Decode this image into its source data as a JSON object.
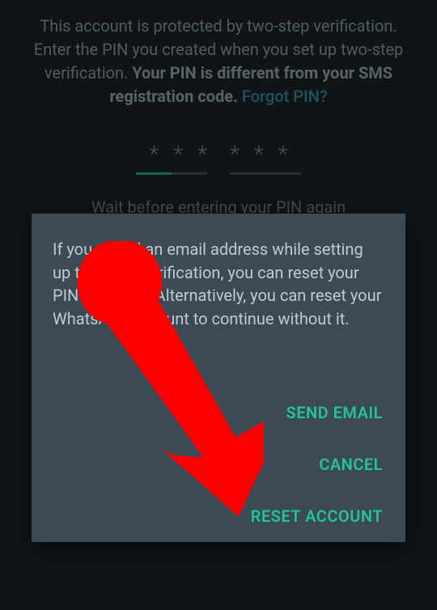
{
  "screen": {
    "instructions_part1": "This account is protected by two-step verification. Enter the PIN you created when you set up two-step verification. ",
    "instructions_bold": "Your PIN is different from your SMS registration code.",
    "forgot_pin_label": " Forgot PIN?",
    "pin_mask_char": "*",
    "wait_text": "Wait before entering your PIN again"
  },
  "dialog": {
    "body": "If you added an email address while setting up two-step verification, you can reset your PIN via email. Alternatively, you can reset your WhatsApp account to continue without it.",
    "actions": {
      "send_email": "SEND EMAIL",
      "cancel": "CANCEL",
      "reset_account": "RESET ACCOUNT"
    }
  },
  "annotation": {
    "arrow_color": "#ff0000"
  }
}
